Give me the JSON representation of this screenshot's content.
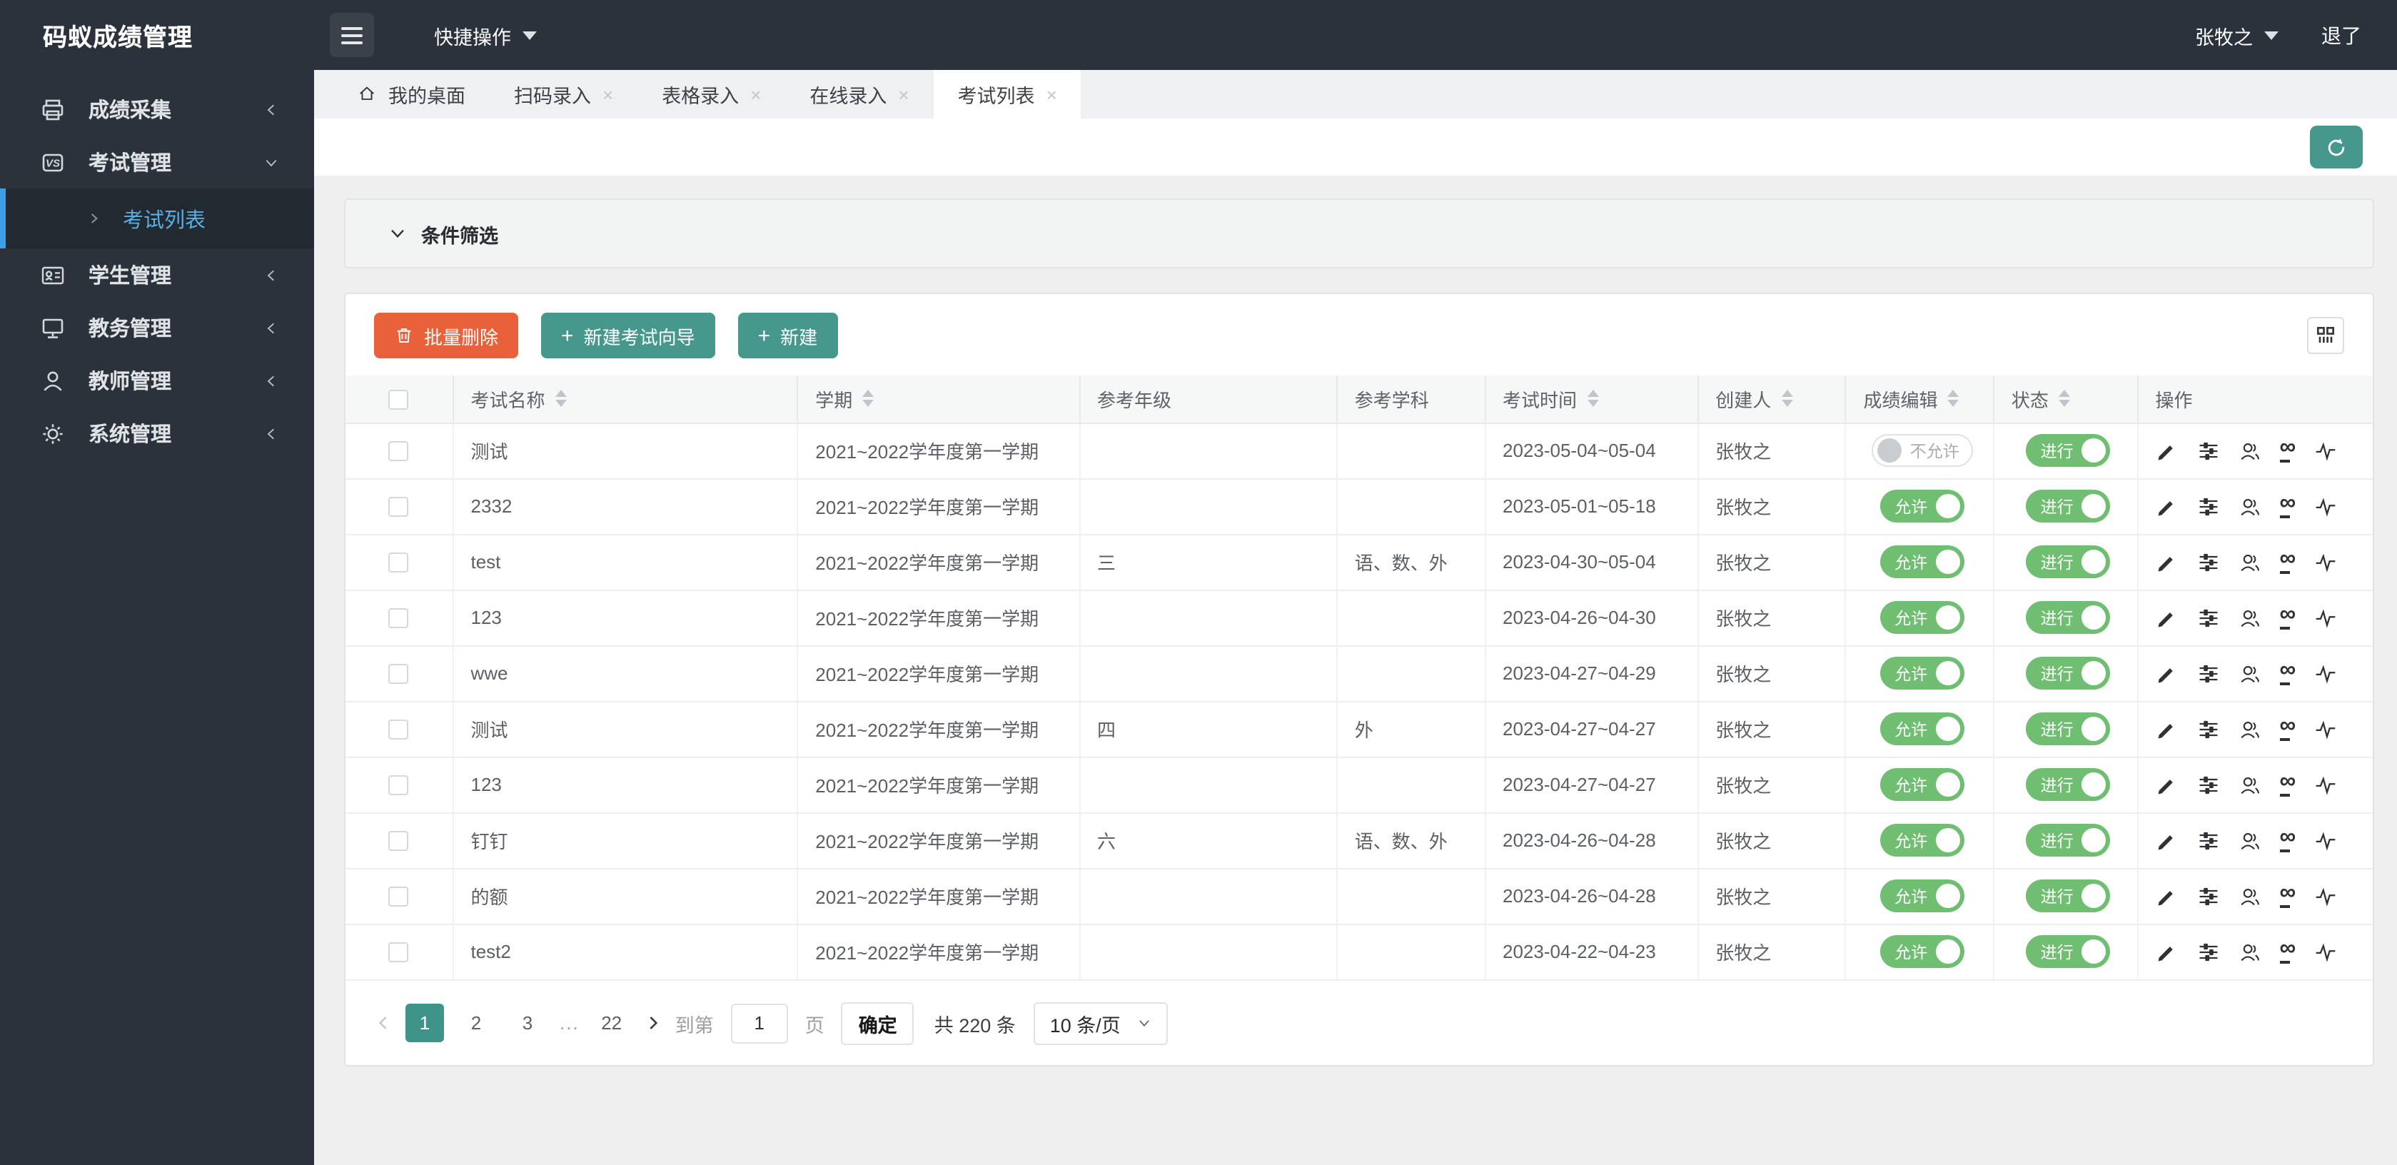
{
  "app": {
    "title": "码蚁成绩管理"
  },
  "topbar": {
    "quick_action": "快捷操作",
    "user": "张牧之",
    "logout": "退了"
  },
  "sidebar": {
    "items": [
      {
        "key": "score-collection",
        "label": "成绩采集",
        "icon": "printer-icon",
        "state": "collapsed"
      },
      {
        "key": "exam-management",
        "label": "考试管理",
        "icon": "vs-badge-icon",
        "state": "expanded",
        "children": [
          {
            "key": "exam-list",
            "label": "考试列表",
            "active": true
          }
        ]
      },
      {
        "key": "student-management",
        "label": "学生管理",
        "icon": "id-card-icon",
        "state": "collapsed"
      },
      {
        "key": "academic-management",
        "label": "教务管理",
        "icon": "monitor-icon",
        "state": "collapsed"
      },
      {
        "key": "teacher-management",
        "label": "教师管理",
        "icon": "user-icon",
        "state": "collapsed"
      },
      {
        "key": "system-management",
        "label": "系统管理",
        "icon": "gear-icon",
        "state": "collapsed"
      }
    ]
  },
  "tabs": [
    {
      "key": "my-desktop",
      "label": "我的桌面",
      "icon": "home-icon",
      "closable": false,
      "active": false
    },
    {
      "key": "scan-entry",
      "label": "扫码录入",
      "closable": true,
      "active": false
    },
    {
      "key": "form-entry",
      "label": "表格录入",
      "closable": true,
      "active": false
    },
    {
      "key": "online-entry",
      "label": "在线录入",
      "closable": true,
      "active": false
    },
    {
      "key": "exam-list",
      "label": "考试列表",
      "closable": true,
      "active": true
    }
  ],
  "filter": {
    "title": "条件筛选"
  },
  "toolbar": {
    "batch_delete": "批量删除",
    "new_exam_wizard": "新建考试向导",
    "new": "新建"
  },
  "table": {
    "columns": [
      {
        "key": "checkbox",
        "label": "",
        "sortable": false,
        "width": "5.3%"
      },
      {
        "key": "name",
        "label": "考试名称",
        "sortable": true,
        "width": "17%"
      },
      {
        "key": "term",
        "label": "学期",
        "sortable": true,
        "width": "13.9%"
      },
      {
        "key": "grade",
        "label": "参考年级",
        "sortable": false,
        "width": "12.7%"
      },
      {
        "key": "subjects",
        "label": "参考学科",
        "sortable": false,
        "width": "7.3%"
      },
      {
        "key": "time",
        "label": "考试时间",
        "sortable": true,
        "width": "10.5%"
      },
      {
        "key": "creator",
        "label": "创建人",
        "sortable": true,
        "width": "7.3%"
      },
      {
        "key": "edit",
        "label": "成绩编辑",
        "sortable": true,
        "width": "7.3%"
      },
      {
        "key": "status",
        "label": "状态",
        "sortable": true,
        "width": "7.1%"
      },
      {
        "key": "ops",
        "label": "操作",
        "sortable": false,
        "width": "11.6%"
      }
    ],
    "op_icons": [
      "edit-pencil-icon",
      "sliders-icon",
      "participants-icon",
      "link-infinity-icon",
      "activity-icon"
    ],
    "rows": [
      {
        "name": "测试",
        "term": "2021~2022学年度第一学期",
        "grade": "",
        "subjects": "",
        "time": "2023-05-04~05-04",
        "creator": "张牧之",
        "edit_label": "不允许",
        "edit_on": false,
        "status_label": "进行",
        "status_on": true
      },
      {
        "name": "2332",
        "term": "2021~2022学年度第一学期",
        "grade": "",
        "subjects": "",
        "time": "2023-05-01~05-18",
        "creator": "张牧之",
        "edit_label": "允许",
        "edit_on": true,
        "status_label": "进行",
        "status_on": true
      },
      {
        "name": "test",
        "term": "2021~2022学年度第一学期",
        "grade": "三",
        "subjects": "语、数、外",
        "time": "2023-04-30~05-04",
        "creator": "张牧之",
        "edit_label": "允许",
        "edit_on": true,
        "status_label": "进行",
        "status_on": true
      },
      {
        "name": "123",
        "term": "2021~2022学年度第一学期",
        "grade": "",
        "subjects": "",
        "time": "2023-04-26~04-30",
        "creator": "张牧之",
        "edit_label": "允许",
        "edit_on": true,
        "status_label": "进行",
        "status_on": true
      },
      {
        "name": "wwe",
        "term": "2021~2022学年度第一学期",
        "grade": "",
        "subjects": "",
        "time": "2023-04-27~04-29",
        "creator": "张牧之",
        "edit_label": "允许",
        "edit_on": true,
        "status_label": "进行",
        "status_on": true
      },
      {
        "name": "测试",
        "term": "2021~2022学年度第一学期",
        "grade": "四",
        "subjects": "外",
        "time": "2023-04-27~04-27",
        "creator": "张牧之",
        "edit_label": "允许",
        "edit_on": true,
        "status_label": "进行",
        "status_on": true
      },
      {
        "name": "123",
        "term": "2021~2022学年度第一学期",
        "grade": "",
        "subjects": "",
        "time": "2023-04-27~04-27",
        "creator": "张牧之",
        "edit_label": "允许",
        "edit_on": true,
        "status_label": "进行",
        "status_on": true
      },
      {
        "name": "钉钉",
        "term": "2021~2022学年度第一学期",
        "grade": "六",
        "subjects": "语、数、外",
        "time": "2023-04-26~04-28",
        "creator": "张牧之",
        "edit_label": "允许",
        "edit_on": true,
        "status_label": "进行",
        "status_on": true
      },
      {
        "name": "的额",
        "term": "2021~2022学年度第一学期",
        "grade": "",
        "subjects": "",
        "time": "2023-04-26~04-28",
        "creator": "张牧之",
        "edit_label": "允许",
        "edit_on": true,
        "status_label": "进行",
        "status_on": true
      },
      {
        "name": "test2",
        "term": "2021~2022学年度第一学期",
        "grade": "",
        "subjects": "",
        "time": "2023-04-22~04-23",
        "creator": "张牧之",
        "edit_label": "允许",
        "edit_on": true,
        "status_label": "进行",
        "status_on": true
      }
    ]
  },
  "pagination": {
    "prev_disabled": true,
    "pages": [
      "1",
      "2",
      "3",
      "...",
      "22"
    ],
    "active_page": "1",
    "goto_label": "到第",
    "goto_value": "1",
    "page_unit": "页",
    "confirm_label": "确定",
    "total_label": "共 220 条",
    "page_size": "10 条/页"
  },
  "colors": {
    "sidebar_bg": "#2b323b",
    "topbar_bg": "#2b323b",
    "active_menu_text": "#54b0e6",
    "active_menu_bar": "#3d9ee4",
    "teal_accent": "#46988c",
    "danger": "#e8613a",
    "toggle_green": "#6fbe72",
    "pagination_active": "#3f948a",
    "page_bg": "#efefef"
  }
}
